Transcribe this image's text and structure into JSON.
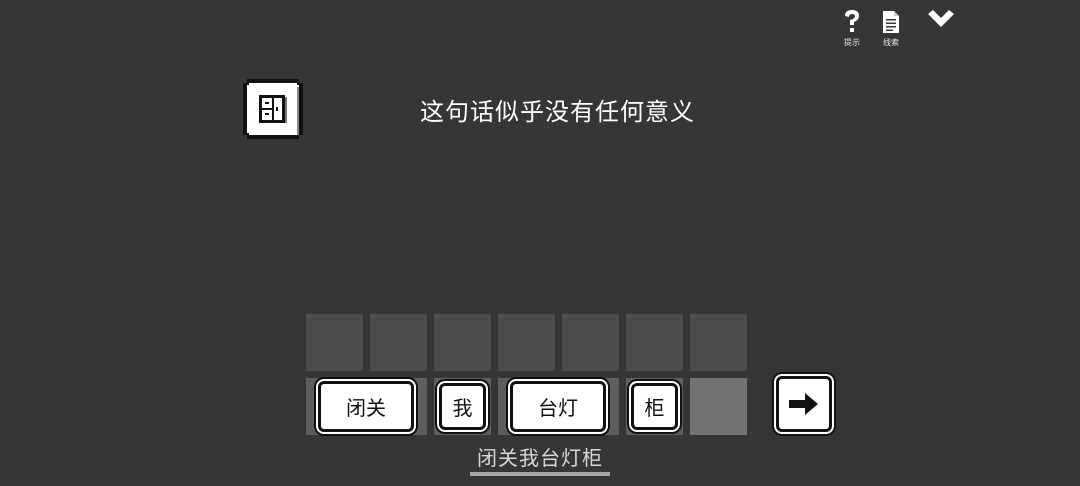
{
  "toolbar": {
    "hint_label": "提示",
    "clues_label": "线索"
  },
  "message": "这句话似乎没有任何意义",
  "tiles": [
    {
      "label": "闭关"
    },
    {
      "label": "我"
    },
    {
      "label": "台灯"
    },
    {
      "label": "柜"
    }
  ],
  "answer": "闭关我台灯柜"
}
